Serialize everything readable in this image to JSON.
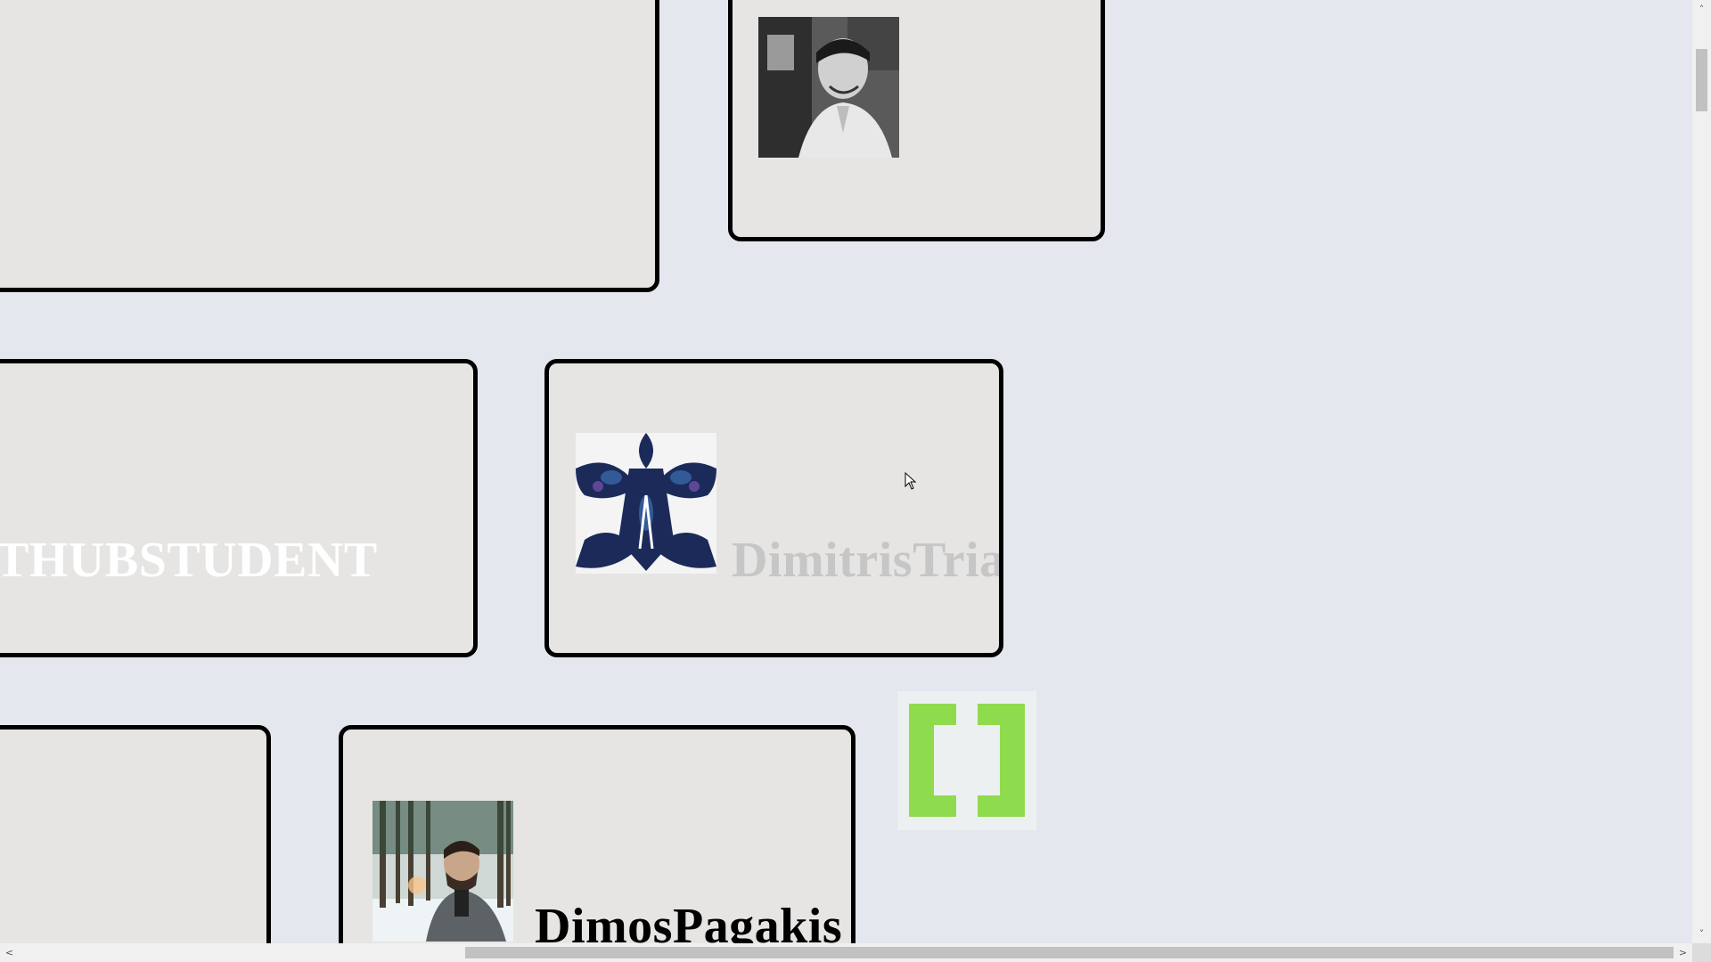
{
  "cards": [
    {
      "id": "card-top-left",
      "name": ""
    },
    {
      "id": "card-top-right",
      "name": ""
    },
    {
      "id": "card-mid-left",
      "name": "THUBSTUDENT"
    },
    {
      "id": "card-mid-right",
      "name": "DimitrisTria"
    },
    {
      "id": "card-bottom-left",
      "name": ""
    },
    {
      "id": "card-bottom-right",
      "name": "DimosPagakis"
    }
  ],
  "logo": {
    "icon": "brackets-logo-icon",
    "color": "#8fdb4e"
  },
  "scrollbars": {
    "up_arrow": "˄",
    "down_arrow": "˅",
    "left_arrow": "<",
    "right_arrow": ">"
  }
}
